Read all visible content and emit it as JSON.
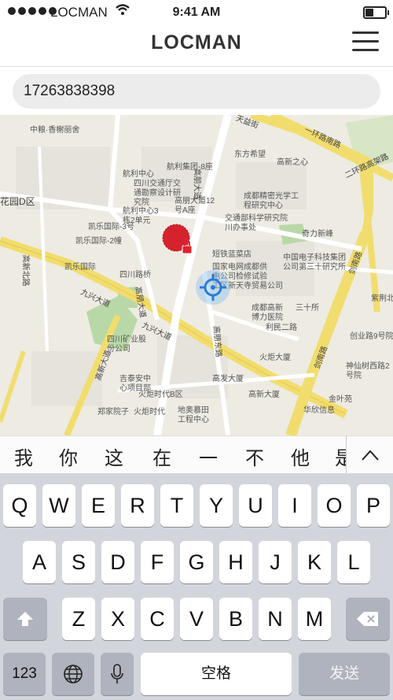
{
  "status_bar": {
    "carrier": "LOCMAN",
    "time": "9:41 AM"
  },
  "nav": {
    "title": "LOCMAN",
    "menu_icon": "hamburger-menu-icon"
  },
  "search": {
    "value": "17263838398"
  },
  "map": {
    "markers": [
      "locked-device-marker",
      "current-location-marker"
    ],
    "labels": [
      "中粮·香榭丽舍",
      "航利中心",
      "航利集团-8座",
      "东方希望",
      "高新之心",
      "四川交通厅交通勘察设计研究院",
      "高朋大道12号A座",
      "成都精密光学工程研究中心",
      "航利中心3栋2单元",
      "航利中心",
      "凯乐国际-3号",
      "交通部科学研究院川办事处",
      "凯乐国际-2幢",
      "奇力新峰",
      "短铁蓝菜店",
      "凯乐国际",
      "国家电网成都供电公司检修试验工区",
      "中国电子科技集团公司第三十研究所",
      "四川路桥",
      "新天寺贸易公司",
      "成都高新博力医院",
      "三十所",
      "利民二路",
      "紫荆北",
      "吉泰安中心项目部",
      "高发大厦",
      "火炬大厦",
      "金叶苑",
      "高新大厦",
      "华欣信息",
      "火炬时代B区",
      "神仙树西路2号院",
      "创业路9号院",
      "地奥慕田工程中心",
      "郑家院子",
      "火炬时代",
      "四川矿业股份公司",
      "锦城大道",
      "花园D区",
      "高新北路",
      "九兴大道",
      "高朋大道",
      "高朋东路",
      "一环路南路",
      "二环路高架路",
      "剑南路",
      "锦城大道",
      "天益街",
      "高新大道"
    ]
  },
  "keyboard": {
    "candidates": [
      "我",
      "你",
      "这",
      "在",
      "一",
      "不",
      "他",
      "是"
    ],
    "collapse_icon": "chevron-up-icon",
    "row1": [
      "Q",
      "W",
      "E",
      "R",
      "T",
      "Y",
      "U",
      "I",
      "O",
      "P"
    ],
    "row2": [
      "A",
      "S",
      "D",
      "F",
      "G",
      "H",
      "J",
      "K",
      "L"
    ],
    "row3": [
      "Z",
      "X",
      "C",
      "V",
      "B",
      "N",
      "M"
    ],
    "shift_icon": "shift-icon",
    "delete_icon": "delete-icon",
    "numbers_label": "123",
    "globe_icon": "globe-icon",
    "mic_icon": "microphone-icon",
    "space_label": "空格",
    "send_label": "发送"
  }
}
